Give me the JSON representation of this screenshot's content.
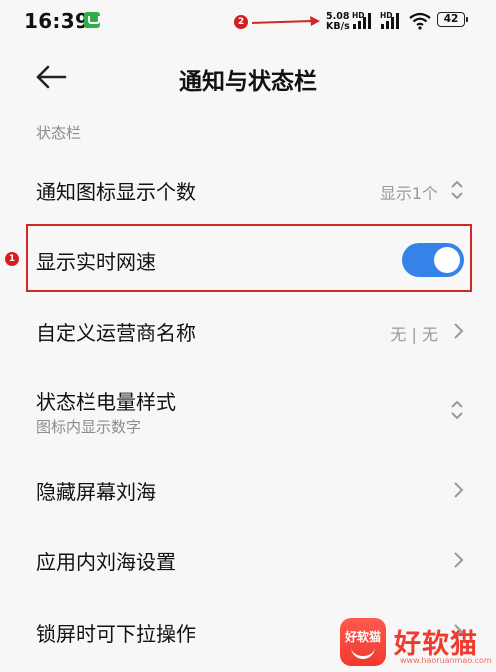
{
  "status_bar": {
    "time": "16:39",
    "network_speed_value": "5.08",
    "network_speed_unit": "KB/s",
    "hd_label_1": "HD",
    "hd_label_2": "HD",
    "battery": "42"
  },
  "annotations": {
    "marker_1": "1",
    "marker_2": "2",
    "highlight_color": "#d12727"
  },
  "header": {
    "back_icon": "arrow-left-icon",
    "title": "通知与状态栏"
  },
  "section": {
    "label": "状态栏"
  },
  "settings": {
    "notification_icon_count": {
      "label": "通知图标显示个数",
      "value": "显示1个",
      "icon": "updown-chevron-icon"
    },
    "realtime_speed": {
      "label": "显示实时网速",
      "enabled": true
    },
    "carrier_name": {
      "label": "自定义运营商名称",
      "value": "无 | 无",
      "icon": "chevron-right-icon"
    },
    "battery_style": {
      "label": "状态栏电量样式",
      "sub": "图标内显示数字",
      "icon": "updown-chevron-icon"
    },
    "hide_notch": {
      "label": "隐藏屏幕刘海",
      "icon": "chevron-right-icon"
    },
    "app_notch": {
      "label": "应用内刘海设置",
      "icon": "chevron-right-icon"
    },
    "lockscreen_pull": {
      "label": "锁屏时可下拉操作",
      "icon": "chevron-right-icon"
    }
  },
  "watermark": {
    "logo_caption": "好软猫",
    "text": "好软猫",
    "url": "www.haoruanmao.com"
  },
  "colors": {
    "accent": "#3583e8",
    "watermark": "#f0392f"
  }
}
